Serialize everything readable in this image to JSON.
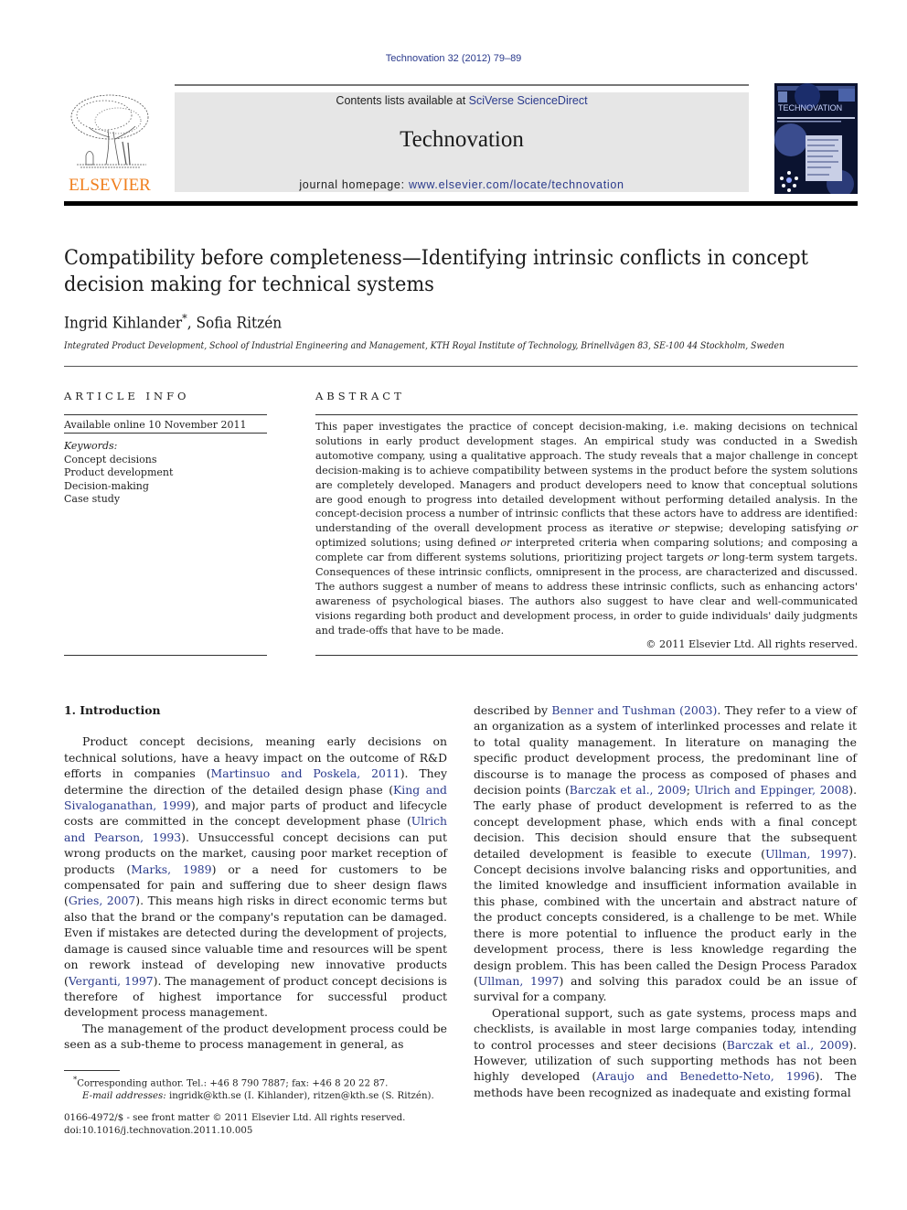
{
  "journal_ref": "Technovation 32 (2012) 79–89",
  "masthead": {
    "contents_prefix": "Contents lists available at ",
    "contents_link": "SciVerse ScienceDirect",
    "journal_title": "Technovation",
    "homepage_prefix": "journal homepage: ",
    "homepage_link": "www.elsevier.com/locate/technovation"
  },
  "publisher": {
    "logo_text": "ELSEVIER",
    "logo_color": "#f07f1e"
  },
  "cover": {
    "title": "TECHNOVATION"
  },
  "article": {
    "title": "Compatibility before completeness—Identifying intrinsic conflicts in concept decision making for technical systems",
    "authors": [
      {
        "name": "Ingrid Kihlander",
        "mark": "*"
      },
      {
        "name": "Sofia Ritzén",
        "mark": ""
      }
    ],
    "author_separator": ", ",
    "affiliation": "Integrated Product Development, School of Industrial Engineering and Management, KTH Royal Institute of Technology, Brinellvägen 83, SE-100 44 Stockholm, Sweden"
  },
  "article_info": {
    "heading": "ARTICLE INFO",
    "available_online": "Available online 10 November 2011",
    "keywords_label": "Keywords:",
    "keywords": [
      "Concept decisions",
      "Product development",
      "Decision-making",
      "Case study"
    ]
  },
  "abstract": {
    "heading": "ABSTRACT",
    "segments": [
      {
        "t": "This paper investigates the practice of concept decision-making, i.e. making decisions on technical solutions in early product development stages. An empirical study was conducted in a Swedish automotive company, using a qualitative approach. The study reveals that a major challenge in concept decision-making is to achieve compatibility between systems in the product before the system solutions are completely developed. Managers and product developers need to know that conceptual solutions are good enough to progress into detailed development without performing detailed analysis. In the concept-decision process a number of intrinsic conflicts that these actors have to address are identified: understanding of the overall development process as iterative "
      },
      {
        "t": "or",
        "i": true
      },
      {
        "t": " stepwise; developing satisfying "
      },
      {
        "t": "or",
        "i": true
      },
      {
        "t": " optimized solutions; using defined "
      },
      {
        "t": "or",
        "i": true
      },
      {
        "t": " interpreted criteria when comparing solutions; and composing a complete car from different systems solutions, prioritizing project targets "
      },
      {
        "t": "or",
        "i": true
      },
      {
        "t": " long-term system targets. Consequences of these intrinsic conflicts, omnipresent in the process, are characterized and discussed. The authors suggest a number of means to address these intrinsic conflicts, such as enhancing actors' awareness of psychological biases. The authors also suggest to have clear and well-communicated visions regarding both product and development process, in order to guide individuals' daily judgments and trade-offs that have to be made."
      }
    ],
    "copyright": "© 2011 Elsevier Ltd. All rights reserved."
  },
  "body": {
    "section_heading": "1.  Introduction",
    "left_paragraphs": [
      [
        {
          "t": "Product concept decisions, meaning early decisions on technical solutions, have a heavy impact on the outcome of R&D efforts in companies ("
        },
        {
          "t": "Martinsuo and Poskela, 2011",
          "link": true
        },
        {
          "t": "). They determine the direction of the detailed design phase ("
        },
        {
          "t": "King and Sivaloganathan, 1999",
          "link": true
        },
        {
          "t": "), and major parts of product and lifecycle costs are committed in the concept development phase ("
        },
        {
          "t": "Ulrich and Pearson, 1993",
          "link": true
        },
        {
          "t": "). Unsuccessful concept decisions can put wrong products on the market, causing poor market reception of products ("
        },
        {
          "t": "Marks, 1989",
          "link": true
        },
        {
          "t": ") or a need for customers to be compensated for pain and suffering due to sheer design flaws ("
        },
        {
          "t": "Gries, 2007",
          "link": true
        },
        {
          "t": "). This means high risks in direct economic terms but also that the brand or the company's reputation can be damaged. Even if mistakes are detected during the development of projects, damage is caused since valuable time and resources will be spent on rework instead of developing new innovative products ("
        },
        {
          "t": "Verganti, 1997",
          "link": true
        },
        {
          "t": "). The management of product concept decisions is therefore of highest importance for successful product development process management."
        }
      ],
      [
        {
          "t": "The management of the product development process could be seen as a sub-theme to process management in general, as"
        }
      ]
    ],
    "right_paragraphs": [
      [
        {
          "t": "described by "
        },
        {
          "t": "Benner and Tushman (2003)",
          "link": true
        },
        {
          "t": ". They refer to a view of an organization as a system of interlinked processes and relate it to total quality management. In literature on managing the specific product development process, the predominant line of discourse is to manage the process as composed of phases and decision points ("
        },
        {
          "t": "Barczak et al., 2009",
          "link": true
        },
        {
          "t": "; "
        },
        {
          "t": "Ulrich and Eppinger, 2008",
          "link": true
        },
        {
          "t": "). The early phase of product development is referred to as the concept development phase, which ends with a final concept decision. This decision should ensure that the subsequent detailed development is feasible to execute ("
        },
        {
          "t": "Ullman, 1997",
          "link": true
        },
        {
          "t": "). Concept decisions involve balancing risks and opportunities, and the limited knowledge and insufficient information available in this phase, combined with the uncertain and abstract nature of the product concepts considered, is a challenge to be met. While there is more potential to influence the product early in the development process, there is less knowledge regarding the design problem. This has been called the Design Process Paradox ("
        },
        {
          "t": "Ullman, 1997",
          "link": true
        },
        {
          "t": ") and solving this paradox could be an issue of survival for a company."
        }
      ],
      [
        {
          "t": "Operational support, such as gate systems, process maps and checklists, is available in most large companies today, intending to control processes and steer decisions ("
        },
        {
          "t": "Barczak et al., 2009",
          "link": true
        },
        {
          "t": "). However, utilization of such supporting methods has not been highly developed ("
        },
        {
          "t": "Araujo and Benedetto-Neto, 1996",
          "link": true
        },
        {
          "t": "). The methods have been recognized as inadequate and existing formal"
        }
      ]
    ]
  },
  "footnote": {
    "mark": "*",
    "corresponding": "Corresponding author. Tel.: +46 8 790 7887; fax: +46 8 20 22 87.",
    "email_label": "E-mail addresses:",
    "emails": " ingridk@kth.se (I. Kihlander), ritzen@kth.se (S. Ritzén)."
  },
  "issn": {
    "line1": "0166-4972/$ - see front matter © 2011 Elsevier Ltd. All rights reserved.",
    "doi": "doi:10.1016/j.technovation.2011.10.005"
  },
  "colors": {
    "link": "#2a3a8c",
    "masthead_bg": "#e6e6e6",
    "elsevier_orange": "#f07f1e"
  }
}
